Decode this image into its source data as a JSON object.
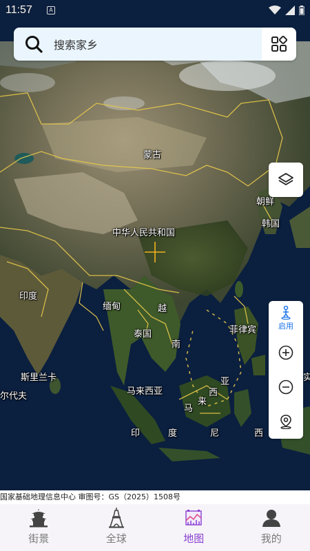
{
  "status_bar": {
    "time": "11:57",
    "notification_badge": "A"
  },
  "search": {
    "placeholder": "搜索家乡"
  },
  "map_labels": {
    "mongolia": "蒙古",
    "china": "中华人民共和国",
    "north_korea": "朝鲜",
    "south_korea": "韩国",
    "india": "印度",
    "myanmar": "缅甸",
    "vietnam_a": "越",
    "vietnam_b": "南",
    "thailand": "泰国",
    "philippines": "菲律宾",
    "sri_lanka": "斯里兰卡",
    "maldives": "尔代夫",
    "malaysia_a": "马来西亚",
    "malaysia_b": "亚",
    "malaysia_c": "西",
    "malaysia_d": "来",
    "malaysia_e": "马",
    "indonesia_a": "印",
    "indonesia_b": "度",
    "indonesia_c": "尼",
    "indonesia_d": "西",
    "east_timor": "亚",
    "right_edge": "实"
  },
  "controls": {
    "enable_label": "启用"
  },
  "attribution": "国家基础地理信息中心  审图号：GS（2025）1508号",
  "nav": {
    "items": [
      {
        "label": "街景",
        "icon": "temple-icon"
      },
      {
        "label": "全球",
        "icon": "tower-icon"
      },
      {
        "label": "地图",
        "icon": "map-chart-icon"
      },
      {
        "label": "我的",
        "icon": "user-icon"
      }
    ],
    "active_index": 2
  },
  "colors": {
    "accent": "#8a3fd1",
    "enable_blue": "#1a73e8",
    "border_yellow": "#e6c84a",
    "ocean": "#0b1f3f"
  }
}
